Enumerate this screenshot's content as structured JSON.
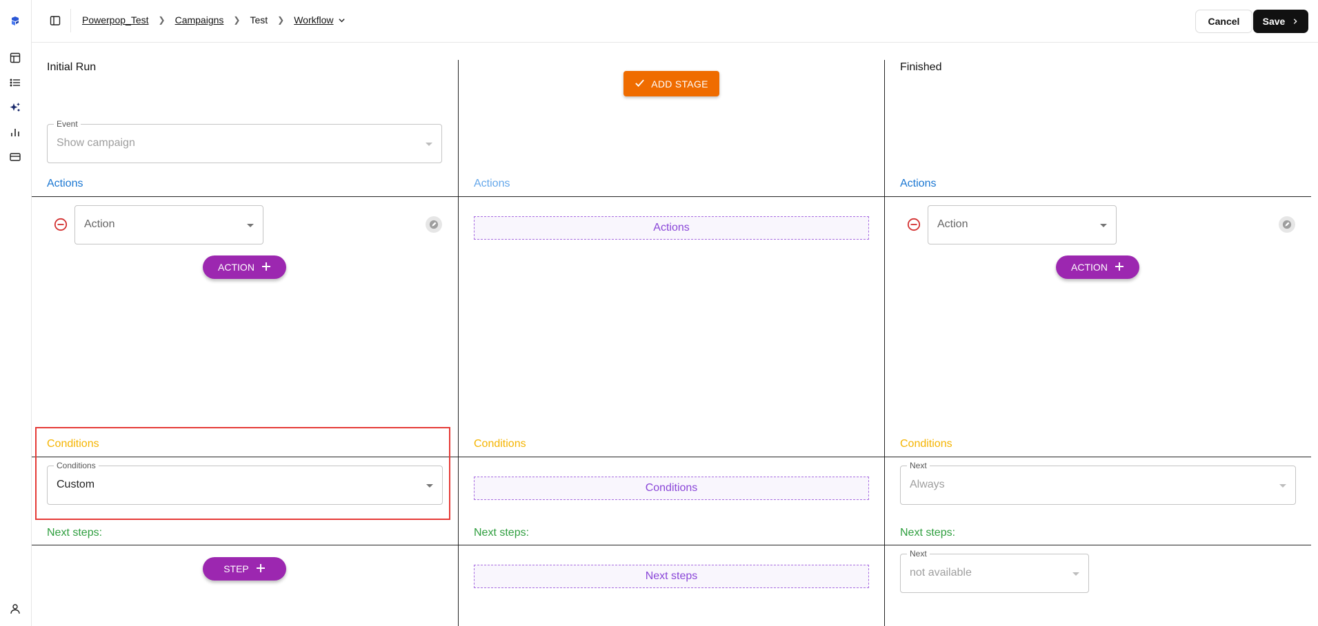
{
  "rail": {
    "icons": [
      "logo-icon",
      "layout-icon",
      "list-icon",
      "sparkles-icon",
      "bar-chart-icon",
      "credit-card-icon",
      "user-icon"
    ]
  },
  "header": {
    "breadcrumbs": [
      "Powerpop_Test",
      "Campaigns",
      "Test",
      "Workflow"
    ],
    "cancel_label": "Cancel",
    "save_label": "Save"
  },
  "add_stage_label": "ADD STAGE",
  "columns": {
    "initial": {
      "title": "Initial Run",
      "event_label": "Event",
      "event_value": "Show campaign",
      "actions_label": "Actions",
      "action_placeholder": "Action",
      "add_action_label": "ACTION",
      "conditions_label": "Conditions",
      "conditions_field_label": "Conditions",
      "conditions_value": "Custom",
      "next_steps_label": "Next steps:",
      "add_step_label": "STEP"
    },
    "middle": {
      "actions_label": "Actions",
      "actions_drop": "Actions",
      "conditions_label": "Conditions",
      "conditions_drop": "Conditions",
      "next_steps_label": "Next steps:",
      "next_steps_drop": "Next steps"
    },
    "finished": {
      "title": "Finished",
      "actions_label": "Actions",
      "action_placeholder": "Action",
      "add_action_label": "ACTION",
      "conditions_label": "Conditions",
      "next_field_label": "Next",
      "next_value": "Always",
      "next_steps_label": "Next steps:",
      "next_steps_field_label": "Next",
      "next_steps_value": "not available"
    }
  },
  "colors": {
    "actions": "#1976d2",
    "conditions": "#f5b400",
    "next_steps": "#2e9e3e",
    "pill": "#9c27b0",
    "add_stage": "#ef6c00",
    "highlight": "#e53935"
  }
}
